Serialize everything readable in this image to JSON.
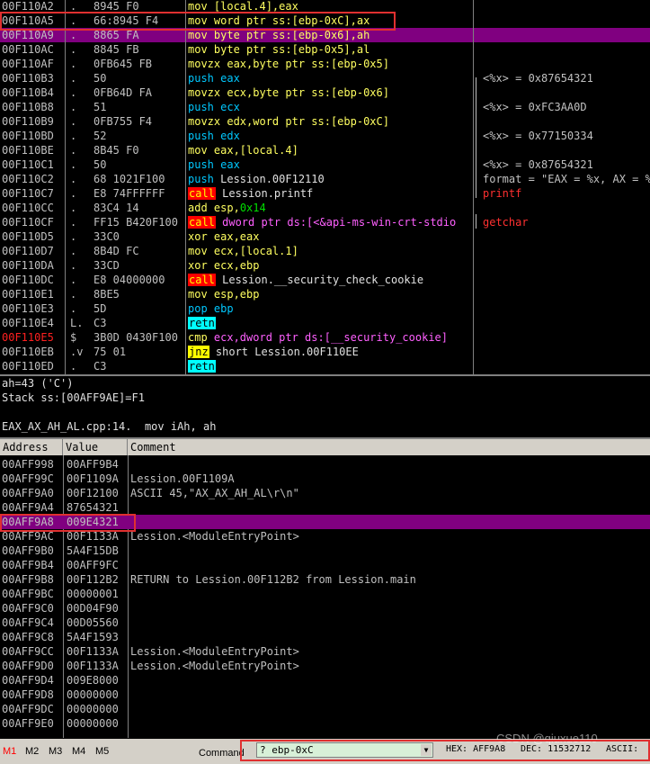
{
  "disasm": {
    "rows": [
      {
        "addr": "00F110A2",
        "mark": ".",
        "bytes": "8945 F0",
        "ins": [
          {
            "t": "mov ",
            "c": "k-mov"
          },
          {
            "t": "[local.4],eax",
            "c": "k-ops"
          }
        ],
        "cmt": ""
      },
      {
        "addr": "00F110A5",
        "mark": ".",
        "bytes": "66:8945 F4",
        "ins": [
          {
            "t": "mov ",
            "c": "k-mov"
          },
          {
            "t": "word ptr ss:[ebp-0xC],ax",
            "c": "k-ops"
          }
        ],
        "cmt": ""
      },
      {
        "addr": "00F110A9",
        "mark": ".",
        "bytes": "8865 FA",
        "ins": [
          {
            "t": "mov ",
            "c": "k-mov"
          },
          {
            "t": "byte ptr ss:[ebp-0x6],ah",
            "c": "k-ops"
          }
        ],
        "cmt": "",
        "sel": true
      },
      {
        "addr": "00F110AC",
        "mark": ".",
        "bytes": "8845 FB",
        "ins": [
          {
            "t": "mov ",
            "c": "k-mov"
          },
          {
            "t": "byte ptr ss:[ebp-0x5],al",
            "c": "k-ops"
          }
        ],
        "cmt": ""
      },
      {
        "addr": "00F110AF",
        "mark": ".",
        "bytes": "0FB645 FB",
        "ins": [
          {
            "t": "movzx ",
            "c": "k-mov"
          },
          {
            "t": "eax,byte ptr ss:[ebp-0x5]",
            "c": "k-ops"
          }
        ],
        "cmt": ""
      },
      {
        "addr": "00F110B3",
        "mark": ".",
        "bytes": "50",
        "ins": [
          {
            "t": "push ",
            "c": "k-push"
          },
          {
            "t": "eax",
            "c": "k-push"
          }
        ],
        "cmt": "<%x> = 0x87654321"
      },
      {
        "addr": "00F110B4",
        "mark": ".",
        "bytes": "0FB64D FA",
        "ins": [
          {
            "t": "movzx ",
            "c": "k-mov"
          },
          {
            "t": "ecx,byte ptr ss:[ebp-0x6]",
            "c": "k-ops"
          }
        ],
        "cmt": ""
      },
      {
        "addr": "00F110B8",
        "mark": ".",
        "bytes": "51",
        "ins": [
          {
            "t": "push ",
            "c": "k-push"
          },
          {
            "t": "ecx",
            "c": "k-push"
          }
        ],
        "cmt": "<%x> = 0xFC3AA0D"
      },
      {
        "addr": "00F110B9",
        "mark": ".",
        "bytes": "0FB755 F4",
        "ins": [
          {
            "t": "movzx ",
            "c": "k-mov"
          },
          {
            "t": "edx,word ptr ss:[ebp-0xC]",
            "c": "k-ops"
          }
        ],
        "cmt": ""
      },
      {
        "addr": "00F110BD",
        "mark": ".",
        "bytes": "52",
        "ins": [
          {
            "t": "push ",
            "c": "k-push"
          },
          {
            "t": "edx",
            "c": "k-push"
          }
        ],
        "cmt": "<%x> = 0x77150334"
      },
      {
        "addr": "00F110BE",
        "mark": ".",
        "bytes": "8B45 F0",
        "ins": [
          {
            "t": "mov ",
            "c": "k-mov"
          },
          {
            "t": "eax,[local.4]",
            "c": "k-ops"
          }
        ],
        "cmt": ""
      },
      {
        "addr": "00F110C1",
        "mark": ".",
        "bytes": "50",
        "ins": [
          {
            "t": "push ",
            "c": "k-push"
          },
          {
            "t": "eax",
            "c": "k-push"
          }
        ],
        "cmt": "<%x> = 0x87654321"
      },
      {
        "addr": "00F110C2",
        "mark": ".",
        "bytes": "68 1021F100",
        "ins": [
          {
            "t": "push ",
            "c": "k-push"
          },
          {
            "t": "Lession.00F12110",
            "c": "k-white"
          }
        ],
        "cmt": "format = \"EAX = %x, AX = %x\""
      },
      {
        "addr": "00F110C7",
        "mark": ".",
        "bytes": "E8 74FFFFFF",
        "ins": [
          {
            "t": "call",
            "c": "k-call"
          },
          {
            "t": " Lession.printf",
            "c": "k-white"
          }
        ],
        "cmt": "printf",
        "cmtRed": true
      },
      {
        "addr": "00F110CC",
        "mark": ".",
        "bytes": "83C4 14",
        "ins": [
          {
            "t": "add ",
            "c": "k-mov"
          },
          {
            "t": "esp,",
            "c": "k-ops"
          },
          {
            "t": "0x14",
            "c": "k-green"
          }
        ],
        "cmt": ""
      },
      {
        "addr": "00F110CF",
        "mark": ".",
        "bytes": "FF15 B420F100",
        "ins": [
          {
            "t": "call",
            "c": "k-call"
          },
          {
            "t": " dword ptr ds:[<&api-ms-win-crt-stdio",
            "c": "k-pink"
          }
        ],
        "cmt": "getchar",
        "cmtRed": true
      },
      {
        "addr": "00F110D5",
        "mark": ".",
        "bytes": "33C0",
        "ins": [
          {
            "t": "xor ",
            "c": "k-mov"
          },
          {
            "t": "eax,eax",
            "c": "k-ops"
          }
        ],
        "cmt": ""
      },
      {
        "addr": "00F110D7",
        "mark": ".",
        "bytes": "8B4D FC",
        "ins": [
          {
            "t": "mov ",
            "c": "k-mov"
          },
          {
            "t": "ecx,[local.1]",
            "c": "k-ops"
          }
        ],
        "cmt": ""
      },
      {
        "addr": "00F110DA",
        "mark": ".",
        "bytes": "33CD",
        "ins": [
          {
            "t": "xor ",
            "c": "k-mov"
          },
          {
            "t": "ecx,ebp",
            "c": "k-ops"
          }
        ],
        "cmt": ""
      },
      {
        "addr": "00F110DC",
        "mark": ".",
        "bytes": "E8 04000000",
        "ins": [
          {
            "t": "call",
            "c": "k-call"
          },
          {
            "t": " Lession.__security_check_cookie",
            "c": "k-white"
          }
        ],
        "cmt": ""
      },
      {
        "addr": "00F110E1",
        "mark": ".",
        "bytes": "8BE5",
        "ins": [
          {
            "t": "mov ",
            "c": "k-mov"
          },
          {
            "t": "esp,ebp",
            "c": "k-ops"
          }
        ],
        "cmt": ""
      },
      {
        "addr": "00F110E3",
        "mark": ".",
        "bytes": "5D",
        "ins": [
          {
            "t": "pop ",
            "c": "k-push"
          },
          {
            "t": "ebp",
            "c": "k-push"
          }
        ],
        "cmt": ""
      },
      {
        "addr": "00F110E4",
        "mark": "L.",
        "bytes": "C3",
        "ins": [
          {
            "t": "retn",
            "c": "k-retn"
          }
        ],
        "cmt": ""
      },
      {
        "addr": "00F110E5",
        "mark": "$",
        "bytes": "3B0D 0430F100",
        "ins": [
          {
            "t": "cmp ",
            "c": "k-mov"
          },
          {
            "t": "ecx,dword ptr ds:[__security_cookie]",
            "c": "k-pink"
          }
        ],
        "cmt": "",
        "addrRed": true
      },
      {
        "addr": "00F110EB",
        "mark": ".v",
        "bytes": "75 01",
        "ins": [
          {
            "t": "jnz",
            "c": "k-jmp"
          },
          {
            "t": " short Lession.00F110EE",
            "c": "k-white"
          }
        ],
        "cmt": ""
      },
      {
        "addr": "00F110ED",
        "mark": ".",
        "bytes": "C3",
        "ins": [
          {
            "t": "retn",
            "c": "k-retn"
          }
        ],
        "cmt": ""
      }
    ]
  },
  "info": {
    "line1": "ah=43 ('C')",
    "line2": "Stack ss:[00AFF9AE]=F1",
    "line3": "",
    "line4": "EAX_AX_AH_AL.cpp:14.  mov iAh, ah"
  },
  "stack": {
    "headers": {
      "address": "Address",
      "value": "Value",
      "comment": "Comment"
    },
    "rows": [
      {
        "addr": "00AFF998",
        "val": "00AFF9B4",
        "cmt": ""
      },
      {
        "addr": "00AFF99C",
        "val": "00F1109A",
        "cmt": "Lession.00F1109A"
      },
      {
        "addr": "00AFF9A0",
        "val": "00F12100",
        "cmt": "ASCII 45,\"AX_AX_AH_AL\\r\\n\""
      },
      {
        "addr": "00AFF9A4",
        "val": "87654321",
        "cmt": ""
      },
      {
        "addr": "00AFF9A8",
        "val": "009E4321",
        "cmt": "",
        "sel": true
      },
      {
        "addr": "00AFF9AC",
        "val": "00F1133A",
        "cmt": "Lession.<ModuleEntryPoint>"
      },
      {
        "addr": "00AFF9B0",
        "val": "5A4F15DB",
        "cmt": ""
      },
      {
        "addr": "00AFF9B4",
        "val": "00AFF9FC",
        "cmt": ""
      },
      {
        "addr": "00AFF9B8",
        "val": "00F112B2",
        "cmt": "RETURN to Lession.00F112B2 from Lession.main"
      },
      {
        "addr": "00AFF9BC",
        "val": "00000001",
        "cmt": ""
      },
      {
        "addr": "00AFF9C0",
        "val": "00D04F90",
        "cmt": ""
      },
      {
        "addr": "00AFF9C4",
        "val": "00D05560",
        "cmt": ""
      },
      {
        "addr": "00AFF9C8",
        "val": "5A4F1593",
        "cmt": ""
      },
      {
        "addr": "00AFF9CC",
        "val": "00F1133A",
        "cmt": "Lession.<ModuleEntryPoint>"
      },
      {
        "addr": "00AFF9D0",
        "val": "00F1133A",
        "cmt": "Lession.<ModuleEntryPoint>"
      },
      {
        "addr": "00AFF9D4",
        "val": "009E8000",
        "cmt": ""
      },
      {
        "addr": "00AFF9D8",
        "val": "00000000",
        "cmt": ""
      },
      {
        "addr": "00AFF9DC",
        "val": "00000000",
        "cmt": ""
      },
      {
        "addr": "00AFF9E0",
        "val": "00000000",
        "cmt": ""
      }
    ]
  },
  "status": {
    "tabs": [
      "M1",
      "M2",
      "M3",
      "M4",
      "M5"
    ],
    "command_label": "Command",
    "command_value": "? ebp-0xC",
    "hex": "HEX: AFF9A8",
    "dec": "DEC: 11532712",
    "ascii": "ASCII:",
    "watermark": "CSDN @qiuxue110"
  }
}
